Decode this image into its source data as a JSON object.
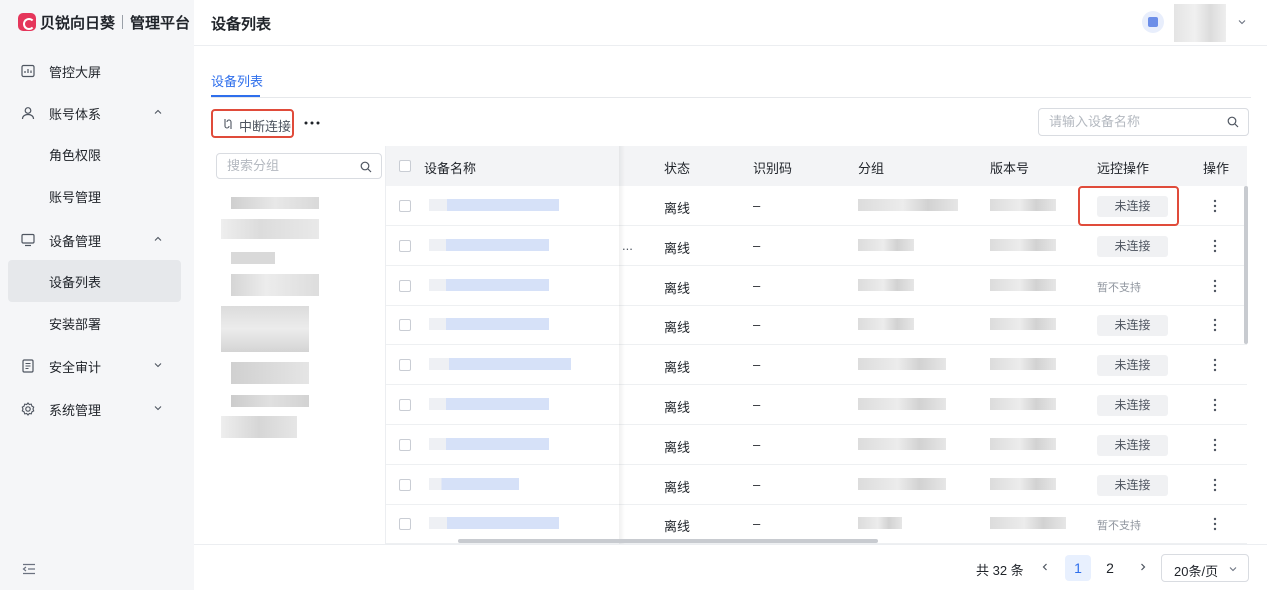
{
  "brand": {
    "name": "贝锐向日葵",
    "subtitle": "管理平台",
    "color": "#e5365b"
  },
  "sidebar": {
    "items": [
      {
        "label": "管控大屏",
        "icon": "dashboard-icon"
      },
      {
        "label": "账号体系",
        "icon": "user-icon",
        "expanded": true
      },
      {
        "label": "角色权限",
        "sub": true
      },
      {
        "label": "账号管理",
        "sub": true
      },
      {
        "label": "设备管理",
        "icon": "monitor-icon",
        "expanded": true
      },
      {
        "label": "设备列表",
        "sub": true,
        "active": true
      },
      {
        "label": "安装部署",
        "sub": true
      },
      {
        "label": "安全审计",
        "icon": "audit-icon",
        "expanded": false
      },
      {
        "label": "系统管理",
        "icon": "settings-icon",
        "expanded": false
      }
    ]
  },
  "header": {
    "title": "设备列表"
  },
  "tabs": [
    {
      "label": "设备列表",
      "active": true
    }
  ],
  "toolbar": {
    "disconnect_label": "中断连接",
    "search_placeholder": "请输入设备名称"
  },
  "group_panel": {
    "search_placeholder": "搜索分组"
  },
  "table": {
    "columns": [
      "设备名称",
      "状态",
      "识别码",
      "分组",
      "版本号",
      "远控操作",
      "操作"
    ],
    "rows": [
      {
        "status": "离线",
        "id_code": "–",
        "remote": "未连接"
      },
      {
        "status": "离线",
        "id_code": "–",
        "remote": "未连接",
        "truncated": "..."
      },
      {
        "status": "离线",
        "id_code": "–",
        "remote": "暂不支持"
      },
      {
        "status": "离线",
        "id_code": "–",
        "remote": "未连接"
      },
      {
        "status": "离线",
        "id_code": "–",
        "remote": "未连接"
      },
      {
        "status": "离线",
        "id_code": "–",
        "remote": "未连接"
      },
      {
        "status": "离线",
        "id_code": "–",
        "remote": "未连接"
      },
      {
        "status": "离线",
        "id_code": "–",
        "remote": "未连接"
      },
      {
        "status": "离线",
        "id_code": "–",
        "remote": "暂不支持"
      }
    ]
  },
  "pagination": {
    "total": "共 32 条",
    "pages": [
      "1",
      "2"
    ],
    "current": "1",
    "page_size": "20条/页"
  },
  "colors": {
    "accent": "#2f6fec",
    "highlight": "#e04b3a"
  }
}
